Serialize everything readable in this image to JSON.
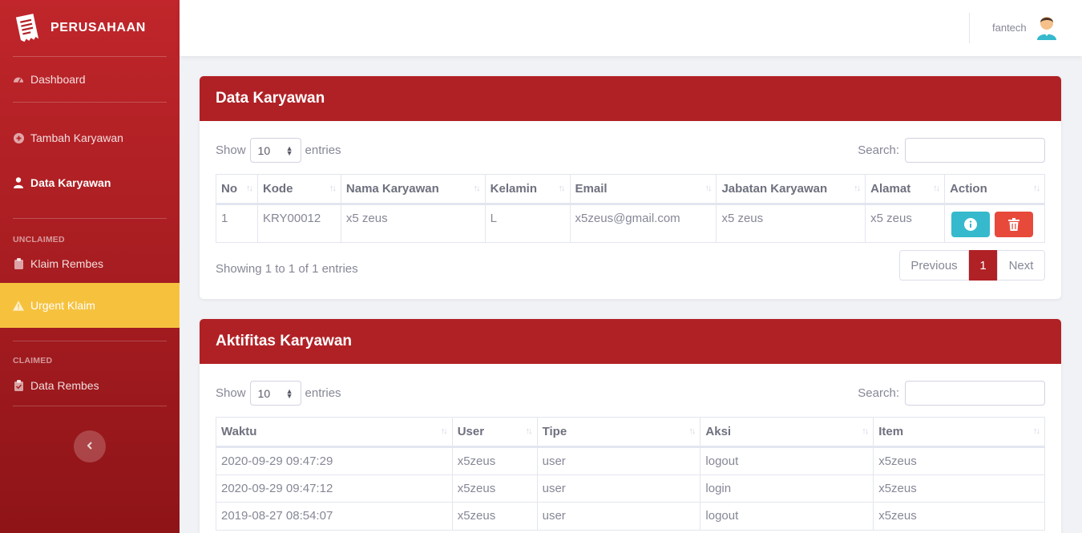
{
  "brand": {
    "name": "PERUSAHAAN",
    "logo_icon": "receipt-icon"
  },
  "sidebar": {
    "dashboard": "Dashboard",
    "tambah_karyawan": "Tambah Karyawan",
    "data_karyawan": "Data Karyawan",
    "heading_unclaimed": "UNCLAIMED",
    "klaim_rembes": "Klaim Rembes",
    "urgent_klaim": "Urgent Klaim",
    "heading_claimed": "CLAIMED",
    "data_rembes": "Data Rembes"
  },
  "topbar": {
    "user_name": "fantech"
  },
  "colors": {
    "primary": "#b02125",
    "warning": "#f6c23e",
    "info": "#36b9cc",
    "danger": "#e74a3b"
  },
  "employees": {
    "title": "Data Karyawan",
    "show_label": "Show",
    "entries_value": "10",
    "entries_label": "entries",
    "search_label": "Search:",
    "columns": [
      "No",
      "Kode",
      "Nama Karyawan",
      "Kelamin",
      "Email",
      "Jabatan Karyawan",
      "Alamat",
      "Action"
    ],
    "rows": [
      [
        "1",
        "KRY00012",
        "x5 zeus",
        "L",
        "x5zeus@gmail.com",
        "x5 zeus",
        "x5 zeus"
      ]
    ],
    "info": "Showing 1 to 1 of 1 entries",
    "pagination": {
      "previous": "Previous",
      "current": "1",
      "next": "Next"
    }
  },
  "activities": {
    "title": "Aktifitas Karyawan",
    "show_label": "Show",
    "entries_value": "10",
    "entries_label": "entries",
    "search_label": "Search:",
    "columns": [
      "Waktu",
      "User",
      "Tipe",
      "Aksi",
      "Item"
    ],
    "rows": [
      [
        "2020-09-29 09:47:29",
        "x5zeus",
        "user",
        "logout",
        "x5zeus"
      ],
      [
        "2020-09-29 09:47:12",
        "x5zeus",
        "user",
        "login",
        "x5zeus"
      ],
      [
        "2019-08-27 08:54:07",
        "x5zeus",
        "user",
        "logout",
        "x5zeus"
      ]
    ]
  }
}
